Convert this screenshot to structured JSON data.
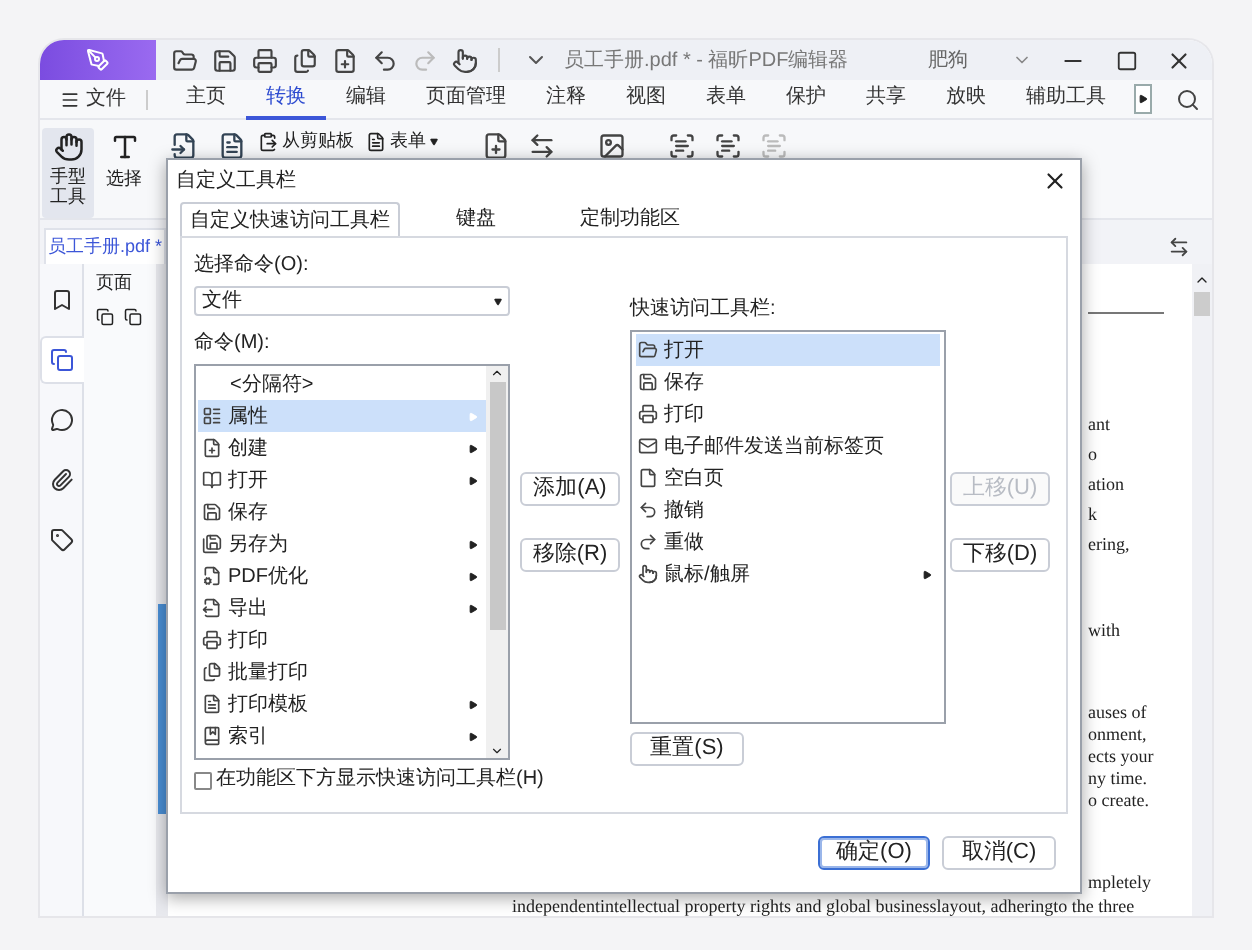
{
  "app": {
    "title": "员工手册.pdf * - 福昕PDF编辑器",
    "user": "肥狗"
  },
  "menu": {
    "file": "文件",
    "tabs": [
      {
        "label": "主页",
        "selected": false
      },
      {
        "label": "转换",
        "selected": true
      },
      {
        "label": "编辑",
        "selected": false
      },
      {
        "label": "页面管理",
        "selected": false
      },
      {
        "label": "注释",
        "selected": false
      },
      {
        "label": "视图",
        "selected": false
      },
      {
        "label": "表单",
        "selected": false
      },
      {
        "label": "保护",
        "selected": false
      },
      {
        "label": "共享",
        "selected": false
      },
      {
        "label": "放映",
        "selected": false
      },
      {
        "label": "辅助工具",
        "selected": false
      }
    ]
  },
  "ribbon": {
    "hand_tool": {
      "label": "手型工具",
      "selected": true
    },
    "select": "选择",
    "from_clipboard": "从剪贴板",
    "form": "表单"
  },
  "doc_tab": "员工手册.pdf *",
  "sidebar": [
    {
      "selected": false
    },
    {
      "selected": true
    },
    {
      "selected": false
    },
    {
      "selected": false
    },
    {
      "selected": false
    }
  ],
  "pages_panel": {
    "title": "页面"
  },
  "document": {
    "paragraphs": [
      [
        "ant",
        "o",
        "ation",
        "k",
        "ering,"
      ],
      [
        "with"
      ],
      [
        "auses of",
        "onment,",
        "ects your",
        "ny time.",
        "o create."
      ],
      [
        "mpletely"
      ]
    ],
    "bottom_line": "independentintellectual  property  rights and global businesslayout, adheringto  the  three"
  },
  "dialog": {
    "title": "自定义工具栏",
    "tabs": [
      {
        "label": "自定义快速访问工具栏",
        "selected": true
      },
      {
        "label": "键盘",
        "selected": false
      },
      {
        "label": "定制功能区",
        "selected": false
      }
    ],
    "choose_label": "选择命令(O):",
    "choose_value": "文件",
    "commands_label": "命令(M):",
    "commands": [
      {
        "kind": "separator",
        "label": "<分隔符>",
        "selected": false,
        "submenu": false
      },
      {
        "kind": "command",
        "label": "属性",
        "selected": true,
        "submenu": true
      },
      {
        "kind": "command",
        "label": "创建",
        "selected": false,
        "submenu": true
      },
      {
        "kind": "command",
        "label": "打开",
        "selected": false,
        "submenu": true
      },
      {
        "kind": "command",
        "label": "保存",
        "selected": false,
        "submenu": false
      },
      {
        "kind": "command",
        "label": "另存为",
        "selected": false,
        "submenu": true
      },
      {
        "kind": "command",
        "label": "PDF优化",
        "selected": false,
        "submenu": true
      },
      {
        "kind": "command",
        "label": "导出",
        "selected": false,
        "submenu": true
      },
      {
        "kind": "command",
        "label": "打印",
        "selected": false,
        "submenu": false
      },
      {
        "kind": "command",
        "label": "批量打印",
        "selected": false,
        "submenu": false
      },
      {
        "kind": "command",
        "label": "打印模板",
        "selected": false,
        "submenu": true
      },
      {
        "kind": "command",
        "label": "索引",
        "selected": false,
        "submenu": true
      }
    ],
    "show_below": {
      "label": "在功能区下方显示快速访问工具栏(H)",
      "checked": false
    },
    "add": "添加(A)",
    "remove": "移除(R)",
    "quick_label": "快速访问工具栏:",
    "quick": [
      {
        "label": "打开",
        "selected": true,
        "submenu": false
      },
      {
        "label": "保存",
        "selected": false,
        "submenu": false
      },
      {
        "label": "打印",
        "selected": false,
        "submenu": false
      },
      {
        "label": "电子邮件发送当前标签页",
        "selected": false,
        "submenu": false
      },
      {
        "label": "空白页",
        "selected": false,
        "submenu": false
      },
      {
        "label": "撤销",
        "selected": false,
        "submenu": false
      },
      {
        "label": "重做",
        "selected": false,
        "submenu": false
      },
      {
        "label": "鼠标/触屏",
        "selected": false,
        "submenu": true
      }
    ],
    "move_up": {
      "label": "上移(U)",
      "disabled": true
    },
    "move_down": {
      "label": "下移(D)",
      "disabled": false
    },
    "reset": "重置(S)",
    "ok": "确定(O)",
    "cancel": "取消(C)"
  }
}
